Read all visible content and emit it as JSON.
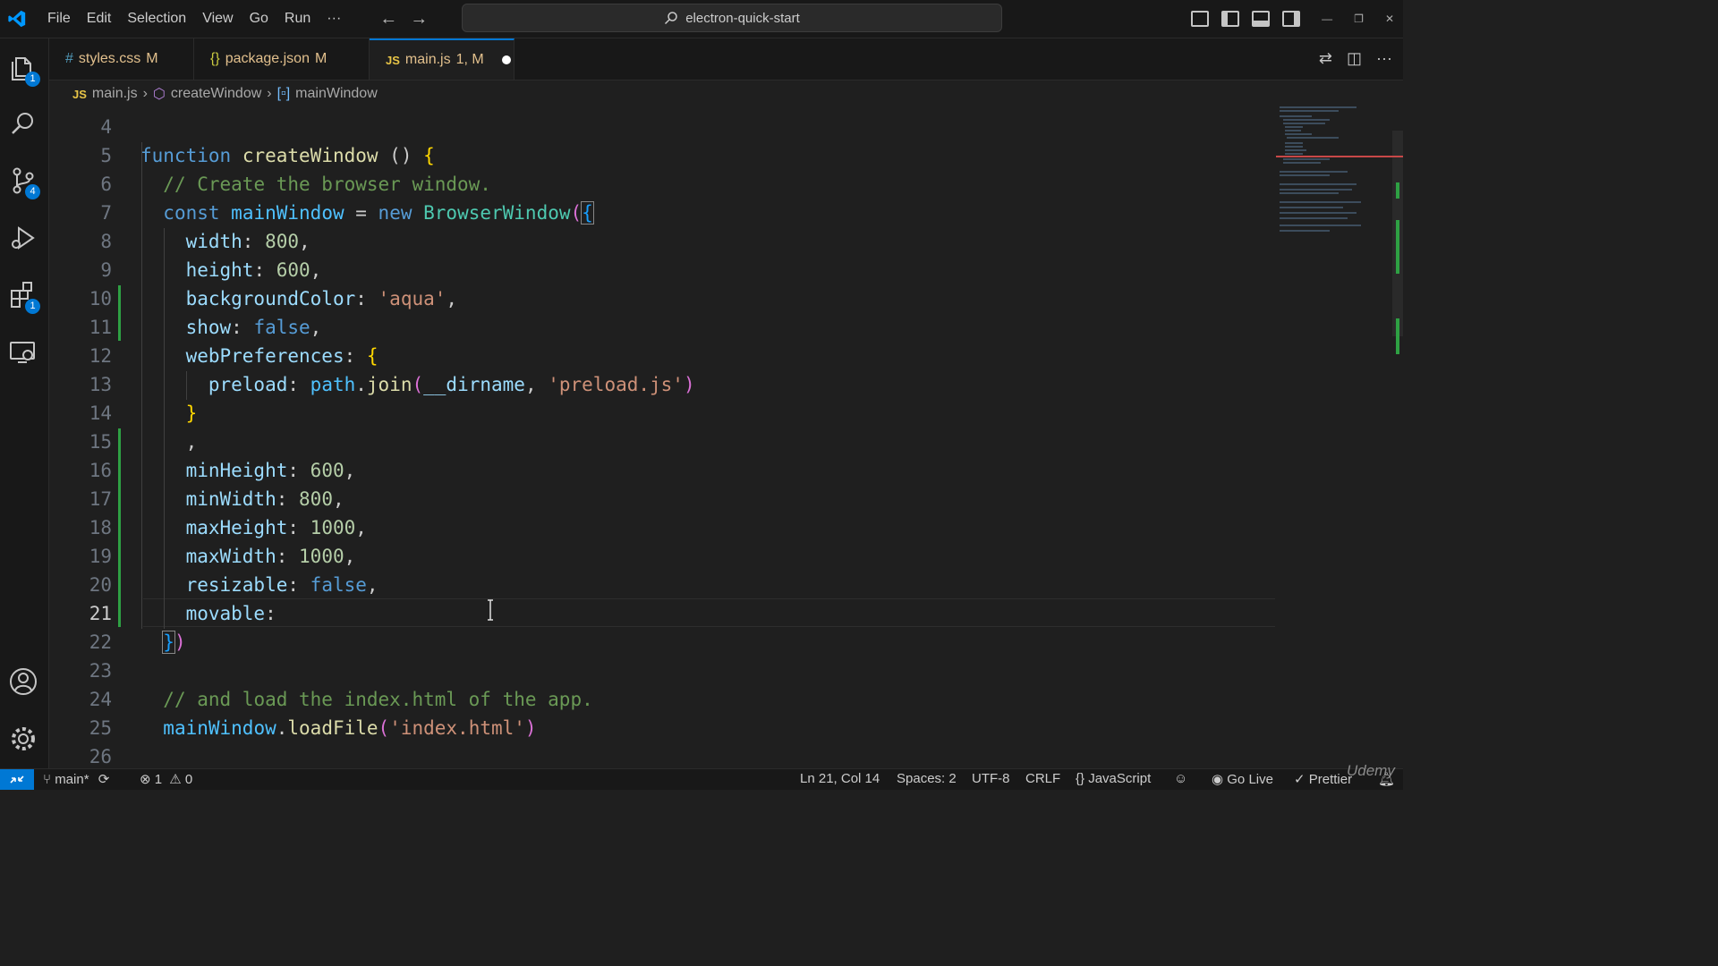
{
  "menu": [
    "File",
    "Edit",
    "Selection",
    "View",
    "Go",
    "Run",
    "···"
  ],
  "command_center": "electron-quick-start",
  "activity_badges": {
    "explorer": "1",
    "source_control": "4",
    "extensions": "1"
  },
  "tabs": [
    {
      "icon": "#",
      "name": "styles.css",
      "status": "M"
    },
    {
      "icon": "{}",
      "name": "package.json",
      "status": "M"
    },
    {
      "icon": "JS",
      "name": "main.js",
      "status": "1, M"
    }
  ],
  "breadcrumb": {
    "file": "main.js",
    "fn": "createWindow",
    "var": "mainWindow",
    "file_icon": "JS"
  },
  "line_numbers": [
    "4",
    "5",
    "6",
    "7",
    "8",
    "9",
    "10",
    "11",
    "12",
    "13",
    "14",
    "15",
    "16",
    "17",
    "18",
    "19",
    "20",
    "21",
    "22",
    "23",
    "24",
    "25",
    "26"
  ],
  "code": {
    "l5_kw": "function",
    "l5_fn": "createWindow",
    "l5_rest": " () ",
    "l6": "// Create the browser window.",
    "l7_kw": "const",
    "l7_var": "mainWindow",
    "l7_eq": " = ",
    "l7_new": "new",
    "l7_cls": "BrowserWindow",
    "l8_prop": "width",
    "l8_val": "800",
    "l9_prop": "height",
    "l9_val": "600",
    "l10_prop": "backgroundColor",
    "l10_val": "'aqua'",
    "l11_prop": "show",
    "l11_val": "false",
    "l12_prop": "webPreferences",
    "l13_prop": "preload",
    "l13_obj": "path",
    "l13_fn": "join",
    "l13_arg": "__dirname",
    "l13_str": "'preload.js'",
    "l15": ",",
    "l16_prop": "minHeight",
    "l16_val": "600",
    "l17_prop": "minWidth",
    "l17_val": "800",
    "l18_prop": "maxHeight",
    "l18_val": "1000",
    "l19_prop": "maxWidth",
    "l19_val": "1000",
    "l20_prop": "resizable",
    "l20_val": "false",
    "l21_prop": "movable",
    "l24": "// and load the index.html of the app.",
    "l25_var": "mainWindow",
    "l25_fn": "loadFile",
    "l25_str": "'index.html'"
  },
  "status": {
    "branch": "main*",
    "errors": "1",
    "warnings": "0",
    "position": "Ln 21, Col 14",
    "spaces": "Spaces: 2",
    "encoding": "UTF-8",
    "eol": "CRLF",
    "language": "JavaScript",
    "golive": "Go Live",
    "prettier": "Prettier"
  },
  "watermark": "Udemy",
  "colors": {
    "accent": "#0078d4",
    "modified": "#e2c08d",
    "added_gutter": "#2ea043"
  }
}
